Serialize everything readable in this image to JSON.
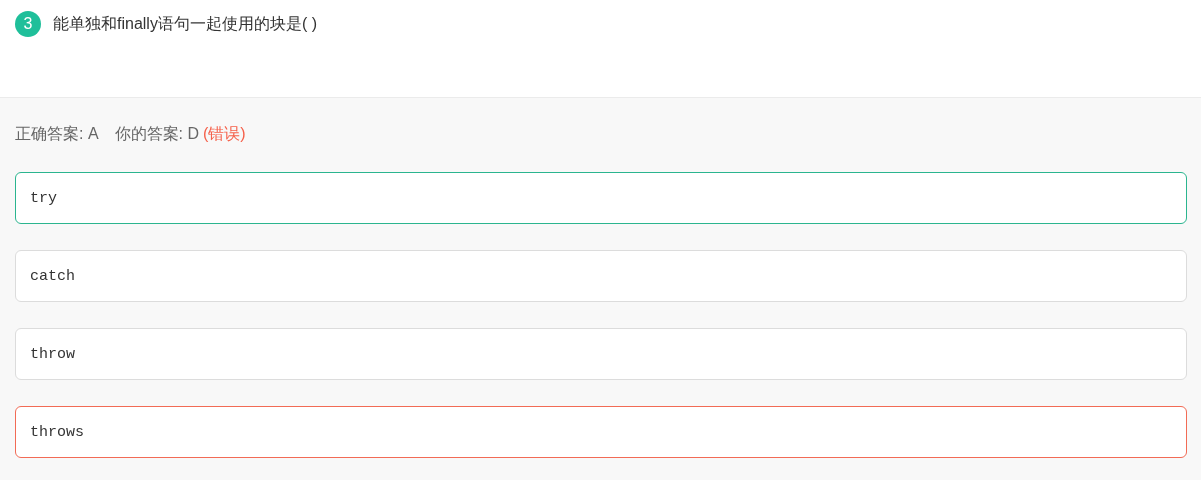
{
  "question": {
    "number": "3",
    "text": "能单独和finally语句一起使用的块是(  )"
  },
  "result": {
    "correct_label": "正确答案: A",
    "your_label": "你的答案: D",
    "verdict": "(错误)"
  },
  "options": [
    {
      "text": "try",
      "correct": true,
      "selected": false
    },
    {
      "text": "catch",
      "correct": false,
      "selected": false
    },
    {
      "text": "throw",
      "correct": false,
      "selected": false
    },
    {
      "text": "throws",
      "correct": false,
      "selected": true
    }
  ]
}
